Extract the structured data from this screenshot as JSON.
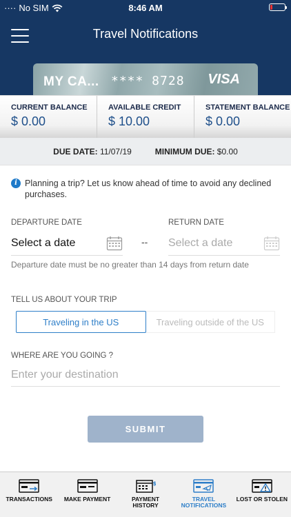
{
  "status": {
    "carrier": "No SIM",
    "time": "8:46 AM"
  },
  "header": {
    "title": "Travel Notifications"
  },
  "card": {
    "name": "MY CA...",
    "number": "**** 8728",
    "brand": "VISA"
  },
  "balances": [
    {
      "label": "CURRENT BALANCE",
      "value": "$ 0.00"
    },
    {
      "label": "AVAILABLE CREDIT",
      "value": "$ 10.00"
    },
    {
      "label": "STATEMENT BALANCE",
      "value": "$ 0.00"
    }
  ],
  "due": {
    "date_label": "DUE DATE:",
    "date_value": "11/07/19",
    "min_label": "MINIMUM DUE:",
    "min_value": "$0.00"
  },
  "info": {
    "text": "Planning a trip? Let us know ahead of time to avoid any declined purchases."
  },
  "form": {
    "departure_label": "DEPARTURE DATE",
    "departure_value": "Select a date",
    "return_label": "RETURN DATE",
    "return_placeholder": "Select a date",
    "separator": "--",
    "date_hint": "Departure date must be no greater than 14 days from return date",
    "trip_label": "TELL US ABOUT YOUR TRIP",
    "trip_options": [
      "Traveling in the US",
      "Traveling outside of the US"
    ],
    "dest_label": "WHERE ARE YOU GOING ?",
    "dest_placeholder": "Enter your destination",
    "submit_label": "SUBMIT"
  },
  "tabs": [
    {
      "label": "TRANSACTIONS",
      "icon": "transactions-icon"
    },
    {
      "label": "MAKE PAYMENT",
      "icon": "make-payment-icon"
    },
    {
      "label": "PAYMENT\nHISTORY",
      "icon": "payment-history-icon"
    },
    {
      "label": "TRAVEL\nNOTIFICATIONS",
      "icon": "travel-notifications-icon",
      "active": true
    },
    {
      "label": "LOST OR STOLEN",
      "icon": "lost-stolen-icon"
    }
  ],
  "colors": {
    "header": "#163763",
    "accent": "#2d7ec8",
    "submit": "#9fb3cb"
  }
}
